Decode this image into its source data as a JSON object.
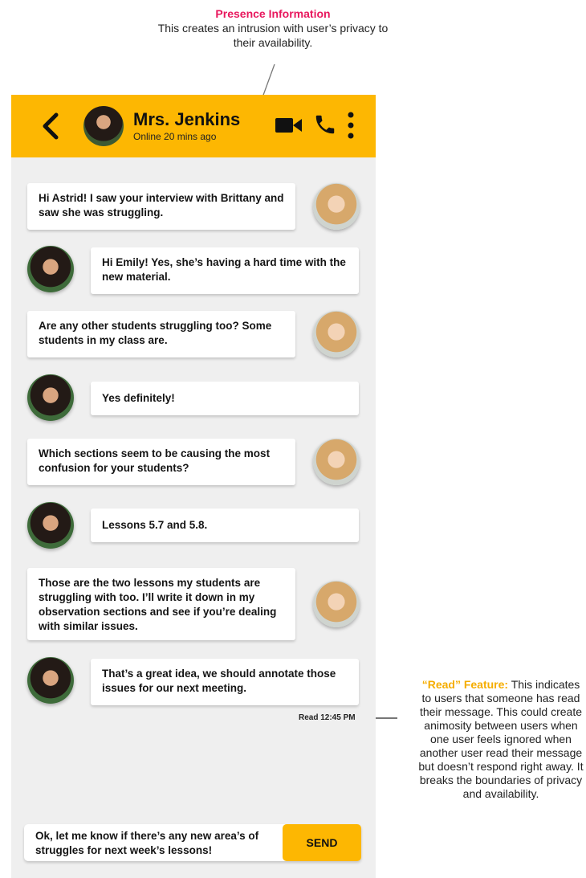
{
  "annotations": {
    "presence": {
      "title": "Presence Information",
      "text": "This creates an intrusion with user’s privacy to their availability."
    },
    "read_feature": {
      "title": "“Read” Feature:",
      "text": "This indicates to users that someone has read their message. This could create animosity between users when one user feels ignored when another user read their message but doesn’t respond right away. It breaks the boundaries of privacy and availability."
    }
  },
  "header": {
    "contact_name": "Mrs. Jenkins",
    "status": "Online 20 mins ago",
    "icons": [
      "back-icon",
      "video-icon",
      "phone-icon",
      "more-icon"
    ],
    "color": "#fdb702"
  },
  "messages": [
    {
      "sender": "Astrid",
      "text": "Hi Astrid! I saw your interview with Brittany and saw she was struggling."
    },
    {
      "sender": "Emily",
      "text": "Hi Emily! Yes, she’s having a hard time with the new material."
    },
    {
      "sender": "Astrid",
      "text": "Are any other students struggling too? Some students in my class are."
    },
    {
      "sender": "Emily",
      "text": "Yes definitely!"
    },
    {
      "sender": "Astrid",
      "text": "Which sections seem to be causing the most confusion for your students?"
    },
    {
      "sender": "Emily",
      "text": "Lessons 5.7 and 5.8."
    },
    {
      "sender": "Astrid",
      "text": "Those are the two lessons my students are struggling with too. I’ll write it down in my observation sections and see if you’re dealing with similar issues."
    },
    {
      "sender": "Emily",
      "text": "That’s a great idea, we should annotate those issues for our next meeting."
    }
  ],
  "read_receipt": "Read 12:45 PM",
  "composer": {
    "text": "Ok, let me know if there’s any new area’s of struggles for next week’s lessons!",
    "send_label": "SEND"
  },
  "colors": {
    "accent": "#fdb702",
    "annotation_title": "#e8175d",
    "read_title": "#f5ad00",
    "chat_bg": "#efefef"
  }
}
